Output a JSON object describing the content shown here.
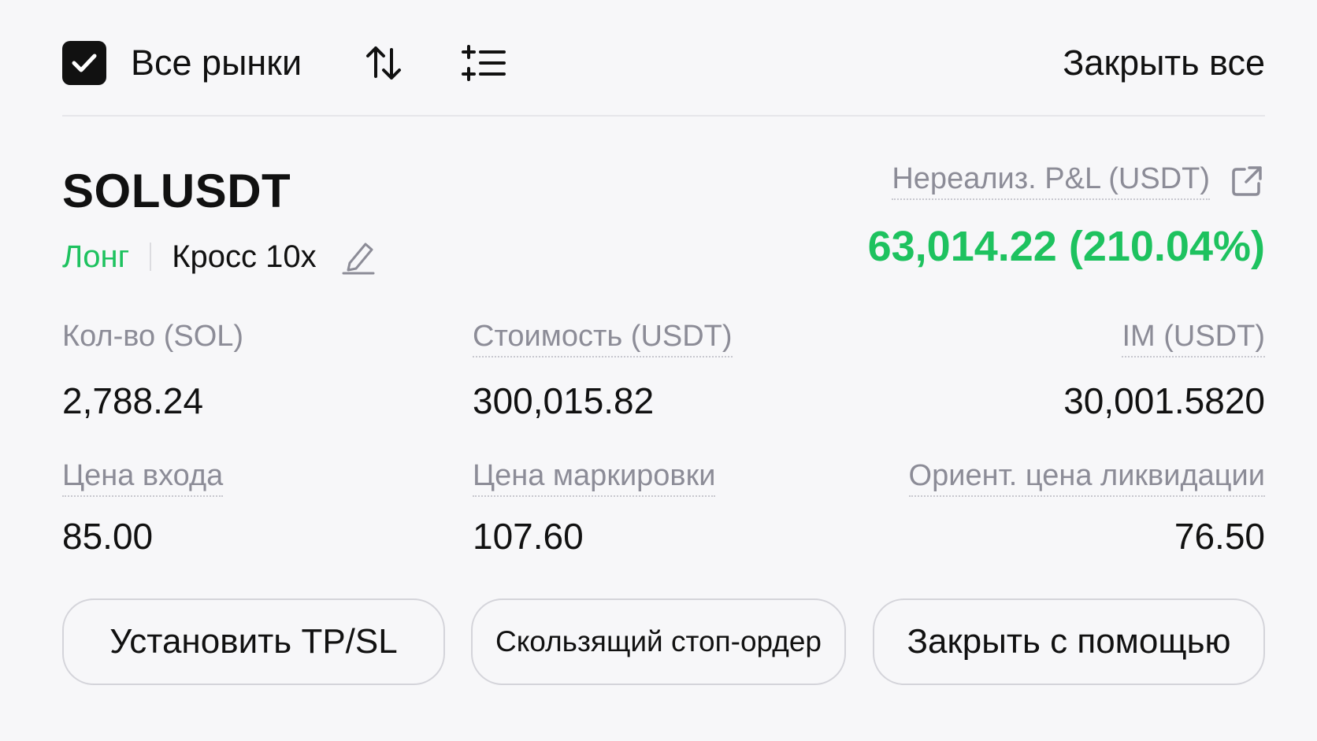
{
  "toolbar": {
    "all_markets_label": "Все рынки",
    "all_markets_checked": true,
    "sort_icon": "sort-arrows-icon",
    "filter_icon": "filter-list-icon",
    "close_all_label": "Закрыть все"
  },
  "position": {
    "symbol": "SOLUSDT",
    "side": "Лонг",
    "margin_mode": "Кросс 10x",
    "pnl_label": "Нереализ. P&L (USDT)",
    "pnl_value": "63,014.22 (210.04%)"
  },
  "stats": {
    "qty_label": "Кол-во (SOL)",
    "qty_value": "2,788.24",
    "value_label": "Стоимость (USDT)",
    "value_value": "300,015.82",
    "im_label": "IM (USDT)",
    "im_value": "30,001.5820",
    "entry_label": "Цена входа",
    "entry_value": "85.00",
    "mark_label": "Цена маркировки",
    "mark_value": "107.60",
    "liq_label": "Ориент. цена ликвидации",
    "liq_value": "76.50"
  },
  "actions": {
    "tpsl_label": "Установить TP/SL",
    "trailing_label": "Скользящий стоп-ордер",
    "close_with_label": "Закрыть с помощью"
  },
  "colors": {
    "profit_green": "#1ec25f",
    "muted_gray": "#8c8c97",
    "text_dark": "#111111",
    "background": "#f7f7f9"
  }
}
